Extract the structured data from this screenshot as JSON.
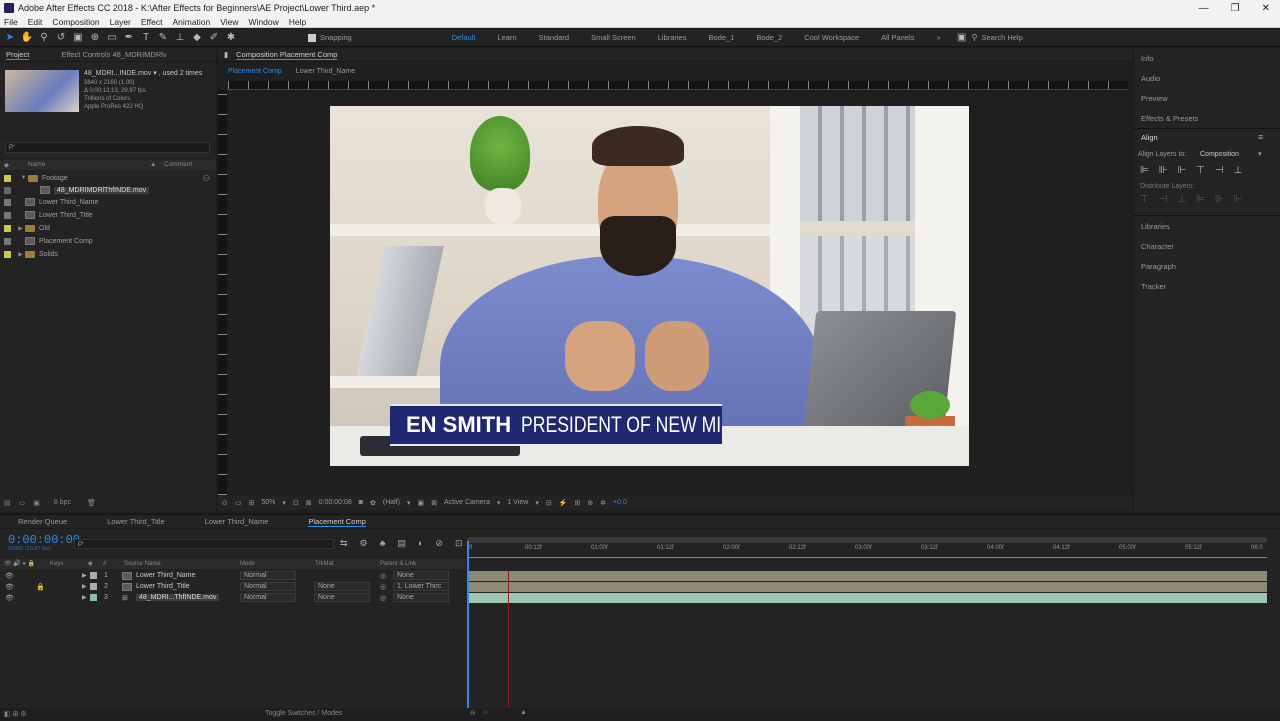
{
  "titlebar": {
    "title": "Adobe After Effects CC 2018 - K:\\After Effects for Beginners\\AE Project\\Lower Third.aep *",
    "min": "—",
    "max": "❐",
    "close": "✕"
  },
  "menu": [
    "File",
    "Edit",
    "Composition",
    "Layer",
    "Effect",
    "Animation",
    "View",
    "Window",
    "Help"
  ],
  "toolbar": {
    "snapping": "Snapping",
    "workspaces": [
      "Default",
      "Learn",
      "Standard",
      "Small Screen",
      "Libraries",
      "Bode_1",
      "Bode_2",
      "Cool Workspace",
      "All Panels"
    ],
    "search_placeholder": "Search Help",
    "more": "»"
  },
  "project": {
    "tab_project": "Project",
    "tab_effect": "Effect Controls 48_MDRIMDRlv",
    "footage_name": "48_MDRI...INDE.mov ▾ , used 2 times",
    "footage_info": [
      "3840 x 2160 (1.00)",
      "Δ 0;00;13;13, 29.97 fps",
      "Trillions of Colors",
      "Apple ProRes 422 HQ"
    ],
    "search_placeholder": "ρ-",
    "col_name": "Name",
    "col_comment": "Comment",
    "items": [
      {
        "label": "Footage",
        "type": "folder",
        "expanded": true,
        "indent": 0
      },
      {
        "label": "48_MDRIMDRlThfINDE.mov",
        "type": "footage",
        "indent": 1,
        "selected": true
      },
      {
        "label": "Lower Third_Name",
        "type": "comp",
        "indent": 0
      },
      {
        "label": "Lower Third_Title",
        "type": "comp",
        "indent": 0
      },
      {
        "label": "Old",
        "type": "folder",
        "indent": 0
      },
      {
        "label": "Placement Comp",
        "type": "comp",
        "indent": 0
      },
      {
        "label": "Solids",
        "type": "folder",
        "indent": 0
      }
    ],
    "bpc": "8 bpc"
  },
  "composition": {
    "tab": "Composition Placement Comp",
    "sub_tabs": [
      "Placement Comp",
      "Lower Third_Name"
    ],
    "lower_third_name": "EN SMITH",
    "lower_third_title": "PRESIDENT OF NEW MI",
    "zoom": "50%",
    "timecode": "0:00:00:08",
    "resolution": "(Half)",
    "camera": "Active Camera",
    "views": "1 View",
    "exposure": "+0.0"
  },
  "right_panel": {
    "items_top": [
      "Info",
      "Audio",
      "Preview",
      "Effects & Presets"
    ],
    "align": "Align",
    "align_to_label": "Align Layers to:",
    "align_to_value": "Composition",
    "distribute": "Distribute Layers:",
    "items_bottom": [
      "Libraries",
      "Character",
      "Paragraph",
      "Tracker"
    ]
  },
  "timeline": {
    "tabs": [
      "Render Queue",
      "Lower Third_Title",
      "Lower Third_Name",
      "Placement Comp"
    ],
    "timecode": "0:00:00:00",
    "timecode_sub": "00000 (29.97 fps)",
    "search_placeholder": "ρ-",
    "headers": {
      "keys": "Keys",
      "num": "#",
      "source": "Source Name",
      "mode": "Mode",
      "trkmat": "TrkMat",
      "parent": "Parent & Link"
    },
    "ruler": [
      "0f",
      "00:12f",
      "01:00f",
      "01:12f",
      "02:00f",
      "02:12f",
      "03:00f",
      "03:12f",
      "04:00f",
      "04:12f",
      "05:00f",
      "05:12f",
      "06:0"
    ],
    "layers": [
      {
        "num": "1",
        "name": "Lower Third_Name",
        "mode": "Normal",
        "trkmat": "",
        "parent": "None"
      },
      {
        "num": "2",
        "name": "Lower Third_Title",
        "mode": "Normal",
        "trkmat": "None",
        "parent": "1. Lower Thirc"
      },
      {
        "num": "3",
        "name": "48_MDRI...ThfINDE.mov",
        "mode": "Normal",
        "trkmat": "None",
        "parent": "None"
      }
    ],
    "toggle_label": "Toggle Switches / Modes"
  },
  "colors": {
    "accent": "#2d8ceb",
    "lower_third": "#1f2870",
    "label_yellow": "#c9c94a"
  }
}
